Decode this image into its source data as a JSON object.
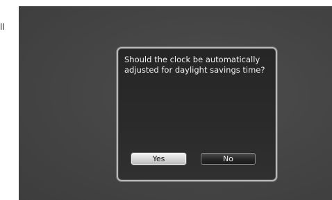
{
  "edge_text": "ll",
  "dialog": {
    "message": "Should the clock be automatically\nadjusted for daylight savings time?",
    "yes_label": "Yes",
    "no_label": "No"
  },
  "colors": {
    "screen_background": "#444444",
    "dialog_background": "#2a2a2a",
    "dialog_border": "#b9b9b9",
    "selected_button": "#d8d8d8",
    "unselected_button": "#262626"
  }
}
